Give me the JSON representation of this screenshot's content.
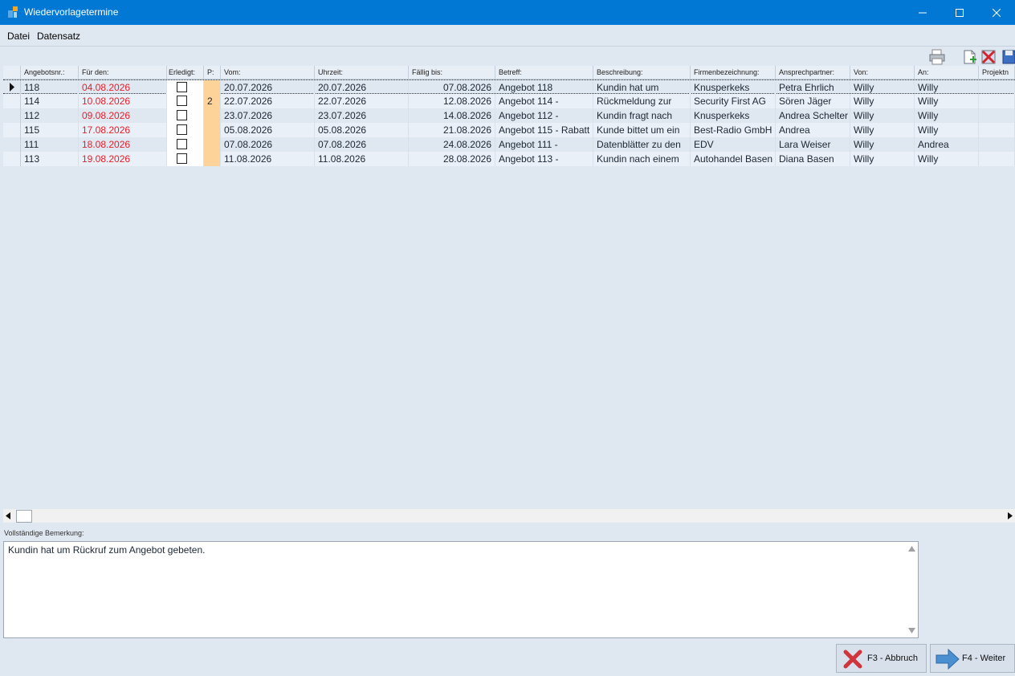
{
  "window": {
    "title": "Wiedervorlagetermine"
  },
  "menu": {
    "items": [
      "Datei",
      "Datensatz"
    ]
  },
  "grid": {
    "columns": [
      "Angebotsnr.:",
      "Für den:",
      "Erledigt:",
      "P:",
      "Vom:",
      "Uhrzeit:",
      "Fällig bis:",
      "Betreff:",
      "Beschreibung:",
      "Firmenbezeichnung:",
      "Ansprechpartner:",
      "Von:",
      "An:",
      "Projektn"
    ],
    "rows": [
      {
        "nr": "118",
        "fuer": "04.08.2026",
        "erledigt": false,
        "p": "",
        "vom": "20.07.2026",
        "uhrzeit": "20.07.2026",
        "faellig": "07.08.2026",
        "betreff": "Angebot 118",
        "beschreibung": "Kundin hat um",
        "firma": "Knusperkeks",
        "ansprech": "Petra Ehrlich",
        "von": "Willy",
        "an": "Willy"
      },
      {
        "nr": "114",
        "fuer": "10.08.2026",
        "erledigt": false,
        "p": "2",
        "vom": "22.07.2026",
        "uhrzeit": "22.07.2026",
        "faellig": "12.08.2026",
        "betreff": "Angebot 114 -",
        "beschreibung": "Rückmeldung zur",
        "firma": "Security First AG",
        "ansprech": "Sören Jäger",
        "von": "Willy",
        "an": "Willy"
      },
      {
        "nr": "112",
        "fuer": "09.08.2026",
        "erledigt": false,
        "p": "",
        "vom": "23.07.2026",
        "uhrzeit": "23.07.2026",
        "faellig": "14.08.2026",
        "betreff": "Angebot 112 -",
        "beschreibung": "Kundin fragt nach",
        "firma": "Knusperkeks",
        "ansprech": "Andrea Schelter",
        "von": "Willy",
        "an": "Willy"
      },
      {
        "nr": "115",
        "fuer": "17.08.2026",
        "erledigt": false,
        "p": "",
        "vom": "05.08.2026",
        "uhrzeit": "05.08.2026",
        "faellig": "21.08.2026",
        "betreff": "Angebot 115 - Rabatt",
        "beschreibung": "Kunde bittet um ein",
        "firma": "Best-Radio GmbH",
        "ansprech": "Andrea",
        "von": "Willy",
        "an": "Willy"
      },
      {
        "nr": "111",
        "fuer": "18.08.2026",
        "erledigt": false,
        "p": "",
        "vom": "07.08.2026",
        "uhrzeit": "07.08.2026",
        "faellig": "24.08.2026",
        "betreff": "Angebot 111 -",
        "beschreibung": "Datenblätter zu den",
        "firma": "EDV",
        "ansprech": "Lara Weiser",
        "von": "Willy",
        "an": "Andrea"
      },
      {
        "nr": "113",
        "fuer": "19.08.2026",
        "erledigt": false,
        "p": "",
        "vom": "11.08.2026",
        "uhrzeit": "11.08.2026",
        "faellig": "28.08.2026",
        "betreff": "Angebot 113 -",
        "beschreibung": "Kundin nach einem",
        "firma": "Autohandel Basen",
        "ansprech": "Diana Basen",
        "von": "Willy",
        "an": "Willy"
      }
    ]
  },
  "remark": {
    "label": "Vollständige Bemerkung:",
    "text": "Kundin hat um Rückruf zum Angebot gebeten."
  },
  "buttons": {
    "cancel": "F3 - Abbruch",
    "next": "F4 - Weiter"
  },
  "colors": {
    "titlebar": "#0078d4",
    "due_date": "#e5202a",
    "priority": "#fdd39a"
  }
}
